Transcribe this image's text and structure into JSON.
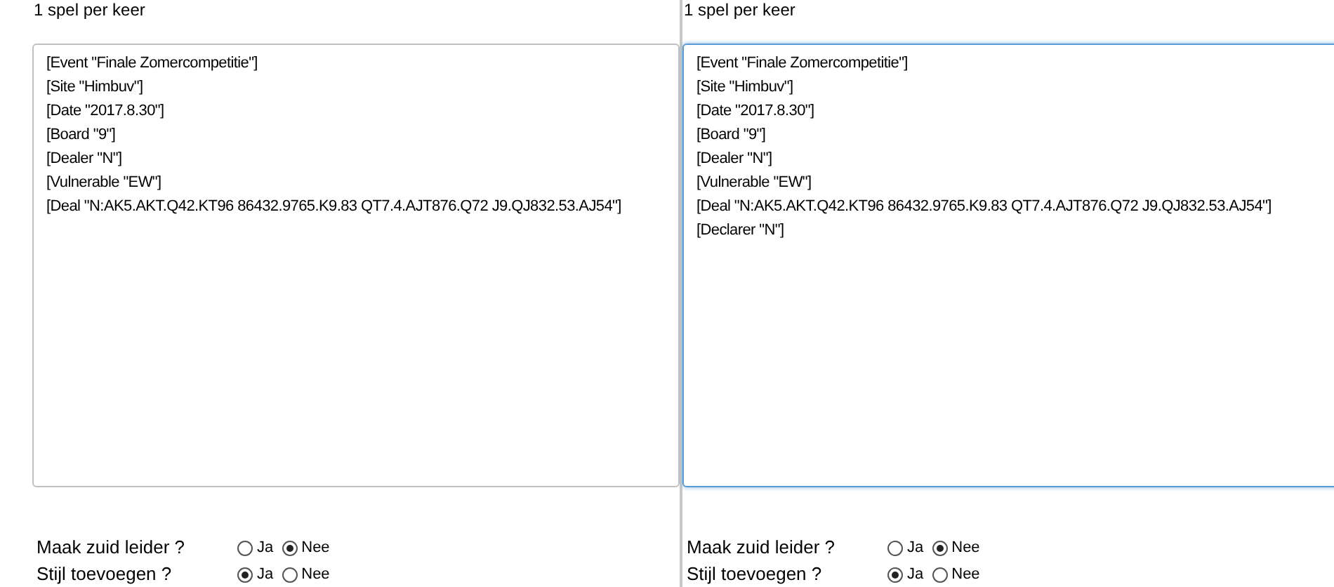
{
  "panels": [
    {
      "heading": "1 spel per keer",
      "focused": false,
      "lines": [
        "[Event \"Finale Zomercompetitie\"]",
        "[Site \"Himbuv\"]",
        "[Date \"2017.8.30\"]",
        "[Board \"9\"]",
        "[Dealer \"N\"]",
        "[Vulnerable \"EW\"]",
        "[Deal \"N:AK5.AKT.Q42.KT96 86432.9765.K9.83 QT7.4.AJT876.Q72 J9.QJ832.53.AJ54\"]"
      ],
      "options": [
        {
          "label": "Maak zuid leider ?",
          "choices": [
            {
              "label": "Ja",
              "selected": false
            },
            {
              "label": "Nee",
              "selected": true
            }
          ]
        },
        {
          "label": "Stijl toevoegen ?",
          "choices": [
            {
              "label": "Ja",
              "selected": true
            },
            {
              "label": "Nee",
              "selected": false
            }
          ]
        }
      ]
    },
    {
      "heading": "1 spel per keer",
      "focused": true,
      "lines": [
        "[Event \"Finale Zomercompetitie\"]",
        "[Site \"Himbuv\"]",
        "[Date \"2017.8.30\"]",
        "[Board \"9\"]",
        "[Dealer \"N\"]",
        "[Vulnerable \"EW\"]",
        "[Deal \"N:AK5.AKT.Q42.KT96 86432.9765.K9.83 QT7.4.AJT876.Q72 J9.QJ832.53.AJ54\"]",
        "[Declarer \"N\"]"
      ],
      "options": [
        {
          "label": "Maak zuid leider ?",
          "choices": [
            {
              "label": "Ja",
              "selected": false
            },
            {
              "label": "Nee",
              "selected": true
            }
          ]
        },
        {
          "label": "Stijl toevoegen ?",
          "choices": [
            {
              "label": "Ja",
              "selected": true
            },
            {
              "label": "Nee",
              "selected": false
            }
          ]
        }
      ]
    }
  ]
}
